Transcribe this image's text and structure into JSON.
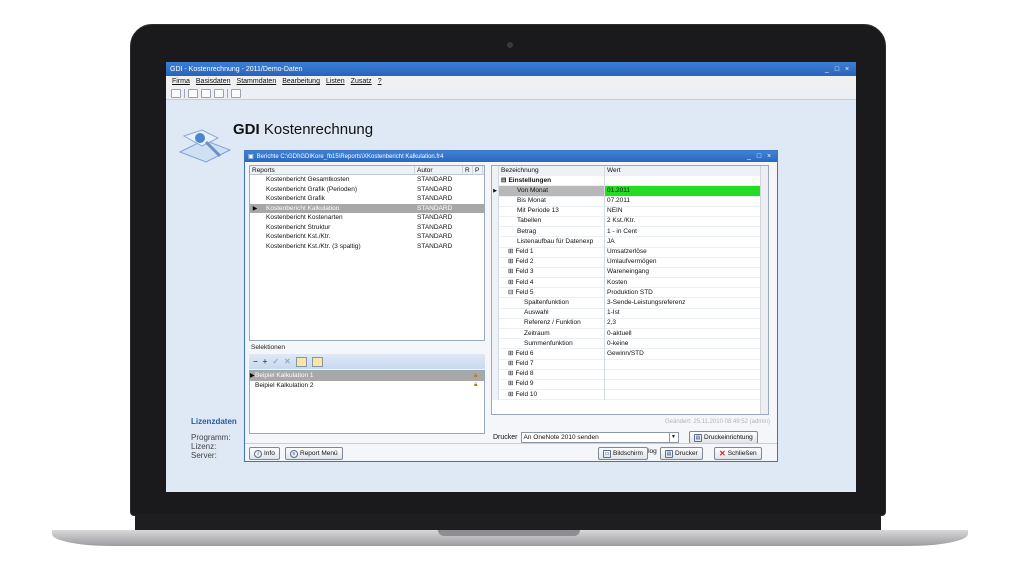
{
  "app": {
    "window_title": "GDI - Kostenrechnung - 2011/Demo-Daten",
    "window_controls": [
      "_",
      "□",
      "×"
    ],
    "menu": [
      "Firma",
      "Basisdaten",
      "Stammdaten",
      "Bearbeitung",
      "Listen",
      "Zusatz",
      "?"
    ],
    "title_bold": "GDI",
    "title_rest": "Kostenrechnung"
  },
  "lizenz": {
    "heading": "Lizenzdaten",
    "programm": "Programm:",
    "lizenz": "Lizenz:",
    "server": "Server:"
  },
  "dialog": {
    "title": "Berichte C:\\GDI\\GDIKore_fb15\\Reports\\XKostenbericht Kalkulation.fr4",
    "controls": [
      "_",
      "□",
      "×"
    ],
    "reports_header": {
      "reports": "Reports",
      "autor": "Autor",
      "r": "R",
      "p": "P"
    },
    "reports": [
      {
        "name": "Kostenbericht Gesamtkosten",
        "autor": "STANDARD"
      },
      {
        "name": "Kostenbericht Grafik (Perioden)",
        "autor": "STANDARD"
      },
      {
        "name": "Kostenbericht Grafik",
        "autor": "STANDARD"
      },
      {
        "name": "Kostenbericht Kalkulation",
        "autor": "STANDARD"
      },
      {
        "name": "Kostenbericht Kostenarten",
        "autor": "STANDARD"
      },
      {
        "name": "Kostenbericht Struktur",
        "autor": "STANDARD"
      },
      {
        "name": "Kostenbericht Kst./Ktr.",
        "autor": "STANDARD"
      },
      {
        "name": "Kostenbericht Kst./Ktr. (3 spaltig)",
        "autor": "STANDARD"
      }
    ],
    "selektionen_label": "Selektionen",
    "selektionen": [
      "Beipiel Kalkulation 1",
      "Beipiel Kalkulation 2"
    ],
    "props_header": {
      "name": "Bezeichnung",
      "value": "Wert"
    },
    "props": [
      {
        "name": "Einstellungen",
        "value": "",
        "indent": 0,
        "exp": "⊟",
        "bold": true
      },
      {
        "name": "Von Monat",
        "value": "01.2011",
        "indent": 2,
        "exp": "",
        "sel": true
      },
      {
        "name": "Bis Monat",
        "value": "07.2011",
        "indent": 2,
        "exp": ""
      },
      {
        "name": "Mit Periode 13",
        "value": "NEIN",
        "indent": 2,
        "exp": ""
      },
      {
        "name": "Tabellen",
        "value": "2 Kst./Ktr.",
        "indent": 2,
        "exp": ""
      },
      {
        "name": "Betrag",
        "value": "1 - in Cent",
        "indent": 2,
        "exp": ""
      },
      {
        "name": "Listenaufbau für Datenexp",
        "value": "JA",
        "indent": 2,
        "exp": ""
      },
      {
        "name": "Feld 1",
        "value": "Umsatzerlöse",
        "indent": 1,
        "exp": "⊞"
      },
      {
        "name": "Feld 2",
        "value": "Umlaufvermögen",
        "indent": 1,
        "exp": "⊞"
      },
      {
        "name": "Feld 3",
        "value": "Wareneingang",
        "indent": 1,
        "exp": "⊞"
      },
      {
        "name": "Feld 4",
        "value": "Kosten",
        "indent": 1,
        "exp": "⊞"
      },
      {
        "name": "Feld 5",
        "value": "Produktion STD",
        "indent": 1,
        "exp": "⊟"
      },
      {
        "name": "Spaltenfunktion",
        "value": "3-Sende-Leistungsreferenz",
        "indent": 3,
        "exp": ""
      },
      {
        "name": "Auswahl",
        "value": "1-Ist",
        "indent": 3,
        "exp": ""
      },
      {
        "name": "Referenz / Funktion",
        "value": "2,3",
        "indent": 3,
        "exp": ""
      },
      {
        "name": "Zeitraum",
        "value": "0-aktuell",
        "indent": 3,
        "exp": ""
      },
      {
        "name": "Summenfunktion",
        "value": "0-keine",
        "indent": 3,
        "exp": ""
      },
      {
        "name": "Feld 6",
        "value": "Gewinn/STD",
        "indent": 1,
        "exp": "⊞"
      },
      {
        "name": "Feld 7",
        "value": "",
        "indent": 1,
        "exp": "⊞"
      },
      {
        "name": "Feld 8",
        "value": "",
        "indent": 1,
        "exp": "⊞"
      },
      {
        "name": "Feld 9",
        "value": "",
        "indent": 1,
        "exp": "⊞"
      },
      {
        "name": "Feld 10",
        "value": "",
        "indent": 1,
        "exp": "⊞"
      }
    ],
    "changed": "Geändert: 25.11.2010 08:49:52 (admin)",
    "drucker_label": "Drucker",
    "drucker_value": "An OneNote 2010 senden",
    "buttons": {
      "druckeinrichtung": "Druckeinrichtung",
      "info": "Info",
      "reportmenu": "Report Menü",
      "mit_druckdialog": "mit Druckdialog",
      "bildschirm": "Bildschirm",
      "drucker": "Drucker",
      "schliessen": "Schließen"
    }
  }
}
